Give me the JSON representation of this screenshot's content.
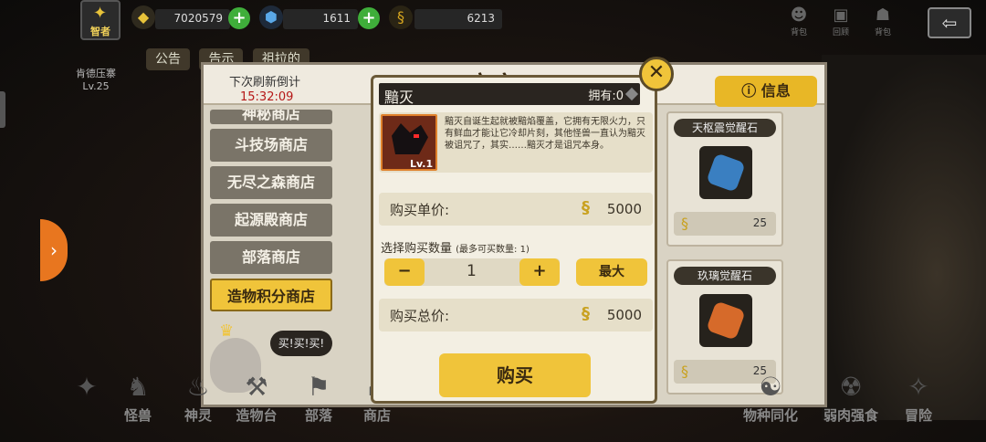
{
  "topbar": {
    "rank": "智者",
    "player_title_line1": "肯德压寨",
    "player_title_line2": "Lv.25",
    "gold": "7020579",
    "gems": "1611",
    "tokens": "6213",
    "icons": [
      {
        "name": "mail-icon",
        "label": "背包"
      },
      {
        "name": "replay-icon",
        "label": "回顾"
      },
      {
        "name": "bag-icon",
        "label": "背包"
      }
    ]
  },
  "announce": {
    "tab1": "公告",
    "tab2": "告示",
    "tab3": "祖拉的"
  },
  "shop": {
    "title": "商店",
    "refresh_label": "下次刷新倒计",
    "refresh_time": "15:32:09",
    "info_label": "信息",
    "tabs": [
      {
        "label": "神秘商店"
      },
      {
        "label": "斗技场商店"
      },
      {
        "label": "无尽之森商店"
      },
      {
        "label": "起源殿商店"
      },
      {
        "label": "部落商店"
      },
      {
        "label": "造物积分商店"
      }
    ],
    "items": [
      {
        "name": "天枢震觉醒石",
        "price": "25",
        "color": "#3a7fc1"
      },
      {
        "name": "玖璃觉醒石",
        "price": "25",
        "color": "#d66a2a"
      }
    ]
  },
  "mascot": {
    "speech": "买!买!买!"
  },
  "bottom_nav": {
    "items": [
      {
        "label": "怪兽"
      },
      {
        "label": "神灵"
      },
      {
        "label": "造物台"
      },
      {
        "label": "部落"
      },
      {
        "label": "商店"
      },
      {
        "label": "物种同化"
      },
      {
        "label": "弱肉强食"
      },
      {
        "label": "冒险"
      }
    ]
  },
  "modal": {
    "item_name": "黯灭",
    "owned": "拥有:0",
    "level": "Lv.1",
    "description": "黯灭自诞生起就被黯焰覆盖，它拥有无限火力，只有鲜血才能让它冷却片刻，其他怪兽一直认为黯灭被诅咒了，其实……黯灭才是诅咒本身。",
    "unit_price_label": "购买单价:",
    "unit_price": "5000",
    "qty_label": "选择购买数量",
    "qty_hint": "(最多可买数量: 1)",
    "qty_minus": "−",
    "qty_value": "1",
    "qty_plus": "+",
    "max_label": "最大",
    "total_label": "购买总价:",
    "total_price": "5000",
    "buy_label": "购买",
    "close_label": "✕"
  },
  "colors": {
    "accent": "#f0c43a",
    "panel": "#f3efe3",
    "dark": "#2a2520"
  }
}
